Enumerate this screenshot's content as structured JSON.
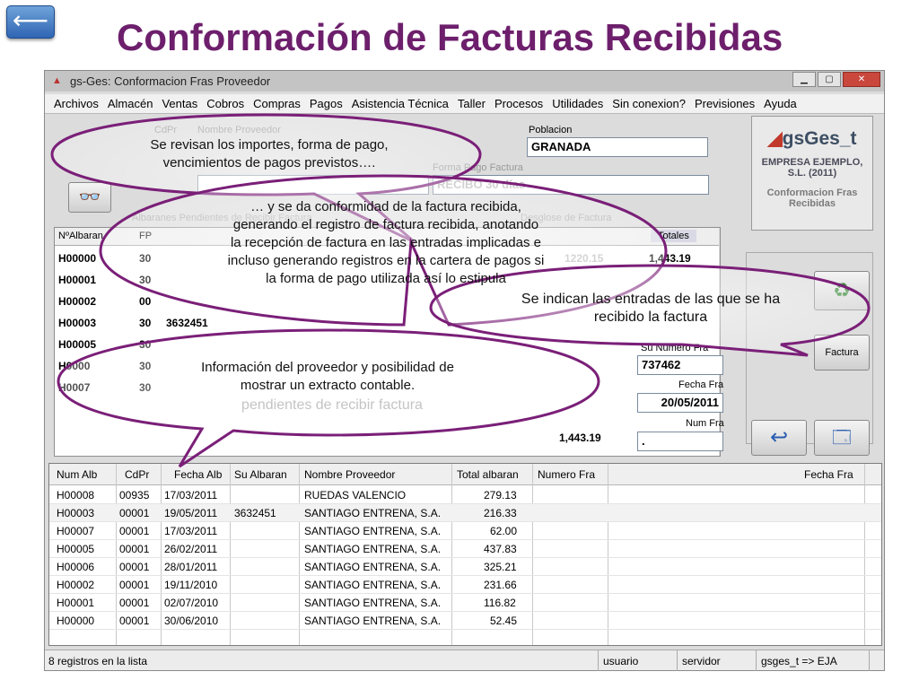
{
  "slide": {
    "back_icon": "left-arrow",
    "back_glyph": "⟵",
    "title": "Conformación de Facturas Recibidas"
  },
  "window": {
    "title": "gs-Ges: Conformacion Fras Proveedor",
    "menu": [
      "Archivos",
      "Almacén",
      "Ventas",
      "Cobros",
      "Compras",
      "Pagos",
      "Asistencia Técnica",
      "Taller",
      "Procesos",
      "Utilidades",
      "Sin conexion?",
      "Previsiones",
      "Ayuda"
    ]
  },
  "form": {
    "cdpr_label": "CdPr",
    "nombre_label": "Nombre Proveedor",
    "poblacion_label": "Poblacion",
    "poblacion_value": "GRANADA",
    "forma_pago_label": "Forma Pago Factura",
    "forma_pago_value": "RECIBO 30 días",
    "albaranes_label": "Albaranes Pendientes de Recibir Factura",
    "desglose_label": "Desglose de Factura",
    "totales_label": "Totales",
    "totales_value": "1,443.19",
    "base_value": "1220.15",
    "su_numero_label": "Su Numero Fra",
    "su_numero_value": "737462",
    "fecha_label": "Fecha Fra",
    "fecha_value": "20/05/2011",
    "num_fra_label": "Num Fra",
    "num_fra_value": ".",
    "total_bottom": "1,443.19",
    "factura_button": "Factura",
    "grid_header": "NºAlbaran",
    "grid_col_fp": "FP",
    "grid_rows": [
      {
        "num": "H00000",
        "fp": "30"
      },
      {
        "num": "H00001",
        "fp": "30"
      },
      {
        "num": "H00002",
        "fp": "00"
      },
      {
        "num": "H00003",
        "fp": "30",
        "su": "3632451"
      },
      {
        "num": "H00005",
        "fp": "30"
      },
      {
        "num": "H0000",
        "fp": "30"
      },
      {
        "num": "H0007",
        "fp": "30"
      }
    ]
  },
  "logo": {
    "name": "gsGes_t",
    "company": "EMPRESA EJEMPLO, S.L. (2011)",
    "caption": "Conformacion Fras Recibidas"
  },
  "list": {
    "headers": [
      "Num Alb",
      "CdPr",
      "Fecha Alb",
      "Su Albaran",
      "Nombre Proveedor",
      "Total albaran",
      "Numero Fra",
      "Fecha Fra"
    ],
    "rows": [
      {
        "num": "H00008",
        "cdpr": "00935",
        "fecha": "17/03/2011",
        "su": "",
        "nombre": "RUEDAS VALENCIO",
        "total": "279.13"
      },
      {
        "num": "H00003",
        "cdpr": "00001",
        "fecha": "19/05/2011",
        "su": "3632451",
        "nombre": "SANTIAGO ENTRENA, S.A.",
        "total": "216.33"
      },
      {
        "num": "H00007",
        "cdpr": "00001",
        "fecha": "17/03/2011",
        "su": "",
        "nombre": "SANTIAGO ENTRENA, S.A.",
        "total": "62.00"
      },
      {
        "num": "H00005",
        "cdpr": "00001",
        "fecha": "26/02/2011",
        "su": "",
        "nombre": "SANTIAGO ENTRENA, S.A.",
        "total": "437.83"
      },
      {
        "num": "H00006",
        "cdpr": "00001",
        "fecha": "28/01/2011",
        "su": "",
        "nombre": "SANTIAGO ENTRENA, S.A.",
        "total": "325.21"
      },
      {
        "num": "H00002",
        "cdpr": "00001",
        "fecha": "19/11/2010",
        "su": "",
        "nombre": "SANTIAGO ENTRENA, S.A.",
        "total": "231.66"
      },
      {
        "num": "H00001",
        "cdpr": "00001",
        "fecha": "02/07/2010",
        "su": "",
        "nombre": "SANTIAGO ENTRENA, S.A.",
        "total": "116.82"
      },
      {
        "num": "H00000",
        "cdpr": "00001",
        "fecha": "30/06/2010",
        "su": "",
        "nombre": "SANTIAGO ENTRENA, S.A.",
        "total": "52.45"
      }
    ]
  },
  "status": {
    "count": "8 registros en la lista",
    "user": "usuario",
    "server": "servidor",
    "db": "gsges_t => EJA"
  },
  "callouts": {
    "c1_line1": "Se revisan los importes, forma de pago,",
    "c1_line2": "vencimientos de pagos previstos….",
    "c2_line1": "… y se da conformidad de la factura recibida,",
    "c2_line2": "generando el registro de factura recibida, anotando",
    "c2_line3": "la recepción de factura en las entradas implicadas e",
    "c2_line4": "incluso generando registros en la cartera de pagos si",
    "c2_line5": "la forma de pago utilizada así lo estipula",
    "c3_line1": "Se indican las entradas de las que se ha",
    "c3_line2": "recibido la factura",
    "c4_line1": "Información del proveedor y posibilidad de",
    "c4_line2": "mostrar un extracto contable.",
    "ghost_line3": "pendientes de recibir factura"
  }
}
